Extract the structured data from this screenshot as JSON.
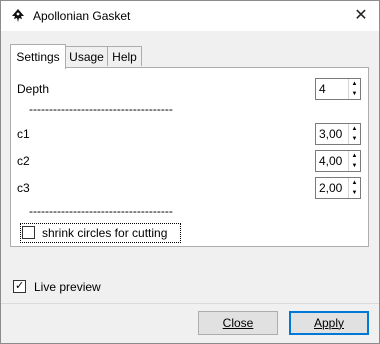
{
  "window": {
    "title": "Apollonian Gasket",
    "close_glyph": "✕"
  },
  "tabs": [
    {
      "label": "Settings",
      "active": true
    },
    {
      "label": "Usage",
      "active": false
    },
    {
      "label": "Help",
      "active": false
    }
  ],
  "settings": {
    "depth": {
      "label": "Depth",
      "value": "4"
    },
    "separator": "------------------------------------",
    "c1": {
      "label": "c1",
      "value": "3,00"
    },
    "c2": {
      "label": "c2",
      "value": "4,00"
    },
    "c3": {
      "label": "c3",
      "value": "2,00"
    },
    "shrink": {
      "label": "shrink circles for cutting",
      "checked": false
    }
  },
  "live_preview": {
    "label": "Live preview",
    "checked": true
  },
  "buttons": {
    "close": "Close",
    "apply": "Apply"
  },
  "icons": {
    "app": "inkscape-icon",
    "spin_up": "▲",
    "spin_down": "▼",
    "check": "✓"
  },
  "colors": {
    "accent": "#0078d7",
    "window_bg": "#f0f0f0",
    "panel_bg": "#ffffff"
  }
}
